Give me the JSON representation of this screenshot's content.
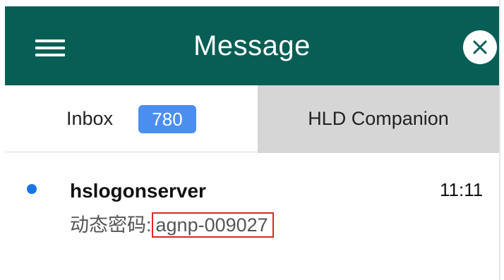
{
  "header": {
    "title": "Message",
    "menu_icon": "hamburger-menu-icon",
    "close_icon": "close-circle-icon",
    "background_color": "#075e54"
  },
  "tabs": {
    "inbox": {
      "label": "Inbox",
      "badge_count": "780",
      "badge_color": "#4a8ef0"
    },
    "companion": {
      "label": "HLD Companion"
    }
  },
  "messages": [
    {
      "sender": "hslogonserver",
      "time": "11:11",
      "preview_prefix": "动态密码:",
      "preview_code": "agnp-009027",
      "unread": true,
      "unread_color": "#1a73e8",
      "highlight_color": "#e02424"
    }
  ]
}
